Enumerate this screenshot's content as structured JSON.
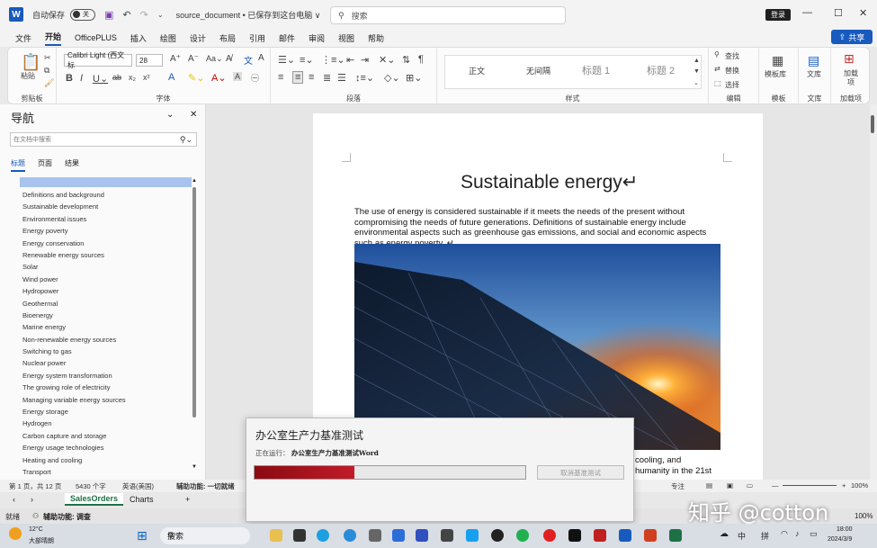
{
  "titlebar": {
    "autosave_label": "自动保存",
    "autosave_state": "关",
    "doc_name": "source_document • 已保存到这台电脑 ∨",
    "search_placeholder": "搜索",
    "login_label": "登录"
  },
  "menu": {
    "tabs": [
      "文件",
      "开始",
      "OfficePLUS",
      "插入",
      "绘图",
      "设计",
      "布局",
      "引用",
      "邮件",
      "审阅",
      "视图",
      "帮助"
    ],
    "active": "开始",
    "share_label": "共享"
  },
  "ribbon": {
    "clipboard": {
      "paste": "粘贴",
      "label": "剪贴板"
    },
    "font": {
      "name": "Calibri Light (西文标",
      "size": "28",
      "label": "字体"
    },
    "paragraph": {
      "label": "段落"
    },
    "styles": {
      "items": [
        "正文",
        "无间隔",
        "标题 1",
        "标题 2"
      ],
      "label": "样式"
    },
    "editing": {
      "find": "查找",
      "replace": "替换",
      "select": "选择",
      "label": "编辑"
    },
    "template": {
      "title": "模板库",
      "label": "模板"
    },
    "library": {
      "title": "文库",
      "label": "文库"
    },
    "addins": {
      "title": "加载项",
      "label": "加载项"
    }
  },
  "nav": {
    "title": "导航",
    "search_placeholder": "在文档中搜索",
    "tabs": [
      "标题",
      "页面",
      "结果"
    ],
    "active_tab": "标题",
    "items": [
      "Definitions and background",
      "Sustainable development",
      "Environmental issues",
      "Energy poverty",
      "Energy conservation",
      "Renewable energy sources",
      "Solar",
      "Wind power",
      "Hydropower",
      "Geothermal",
      "Bioenergy",
      "Marine energy",
      "Non-renewable energy sources",
      "Switching to gas",
      "Nuclear power",
      "Energy system transformation",
      "The growing role of electricity",
      "Managing variable energy sources",
      "Energy storage",
      "Hydrogen",
      "Carbon capture and storage",
      "Energy usage technologies",
      "Heating and cooling",
      "Transport"
    ]
  },
  "document": {
    "title": "Sustainable energy↵",
    "body": "The use of energy is considered sustainable if it meets the needs of the present without compromising the needs of future generations. Definitions of sustainable energy include environmental aspects such as greenhouse gas emissions, and social and economic aspects such as energy poverty. ↵",
    "tail1": "cooling, and",
    "tail2": "humanity in the 21st"
  },
  "statusbar": {
    "page": "第 1 页，共 12 页",
    "words": "5430 个字",
    "language": "英语(美国)",
    "accessibility": "辅助功能: 一切就绪",
    "focus": "专注",
    "zoom": "100%"
  },
  "excel": {
    "sheets": [
      "SalesOrders",
      "Charts"
    ],
    "ready": "就绪",
    "accessibility": "辅助功能: 调查",
    "zoom": "100%"
  },
  "dialog": {
    "title": "办公室生产力基准测试",
    "status_prefix": "正在运行：",
    "status_task": "办公室生产力基准测试Word",
    "progress": 0.37,
    "cancel_label": "取消基准测试"
  },
  "taskbar": {
    "weather_temp": "12°C",
    "weather_desc": "大部晴朗",
    "search_label": "搜索",
    "ime1": "中",
    "ime2": "拼",
    "time": "18:00",
    "date": "2024/3/9"
  },
  "watermark": "知乎 @cotton",
  "colors": {
    "word_blue": "#185abd",
    "progress_red": "#b0141e"
  }
}
